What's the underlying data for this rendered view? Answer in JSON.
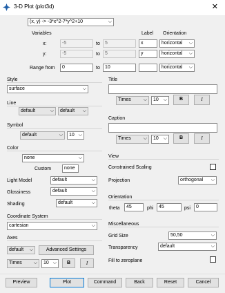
{
  "window": {
    "title": "3-D Plot (plot3d)",
    "close_glyph": "✕"
  },
  "function_select": {
    "value": "(x, y) -> -3*x^2-7*y^2+10"
  },
  "variables": {
    "header": "Variables",
    "label_header": "Label",
    "orientation_header": "Orientation",
    "x": {
      "name": "x:",
      "from": "-5",
      "to_word": "to",
      "to": "5",
      "label": "x",
      "orientation": "horizontal"
    },
    "y": {
      "name": "y:",
      "from": "-5",
      "to_word": "to",
      "to": "5",
      "label": "y",
      "orientation": "horizontal"
    },
    "range": {
      "name": "Range from",
      "from": "0",
      "to_word": "to",
      "to": "10",
      "label": "",
      "orientation": "horizontal"
    }
  },
  "style": {
    "header": "Style",
    "value": "surface"
  },
  "line": {
    "header": "Line",
    "value1": "default",
    "value2": "default"
  },
  "symbol": {
    "header": "Symbol",
    "value": "default",
    "size": "10"
  },
  "color": {
    "header": "Color",
    "value": "none",
    "custom_label": "Custom",
    "custom_value": "none"
  },
  "light_model": {
    "label": "Light Model",
    "value": "default"
  },
  "glossiness": {
    "label": "Glossiness",
    "value": "default"
  },
  "shading": {
    "label": "Shading",
    "value": "default"
  },
  "coordinate_system": {
    "header": "Coordinate System",
    "value": "cartesian"
  },
  "axes": {
    "header": "Axes",
    "value": "default",
    "advanced_button": "Advanced Settings",
    "font": "Times",
    "size": "10",
    "bold": "B",
    "italic": "I"
  },
  "title": {
    "header": "Title",
    "value": "",
    "font": "Times",
    "size": "10",
    "bold": "B",
    "italic": "I"
  },
  "caption": {
    "header": "Caption",
    "value": "",
    "font": "Times",
    "size": "10",
    "bold": "B",
    "italic": "I"
  },
  "view": {
    "header": "View",
    "constrained_label": "Constrained Scaling",
    "constrained_checked": false,
    "projection_label": "Projection",
    "projection_value": "orthogonal"
  },
  "orientation": {
    "header": "Orientation",
    "theta_label": "theta",
    "theta": "45",
    "phi_label": "phi",
    "phi": "45",
    "psi_label": "psi",
    "psi": "0"
  },
  "misc": {
    "header": "Miscellaneous",
    "grid_label": "Grid Size",
    "grid_value": "50,50",
    "transparency_label": "Transparency",
    "transparency_value": "default",
    "fill_label": "Fill to zeroplane",
    "fill_checked": false
  },
  "buttons": {
    "preview": "Preview",
    "plot": "Plot",
    "command": "Command",
    "back": "Back",
    "reset": "Reset",
    "cancel": "Cancel"
  },
  "colors": {
    "accent": "#0078d7",
    "background": "#f0f0f0",
    "border": "#8a8a8a"
  }
}
